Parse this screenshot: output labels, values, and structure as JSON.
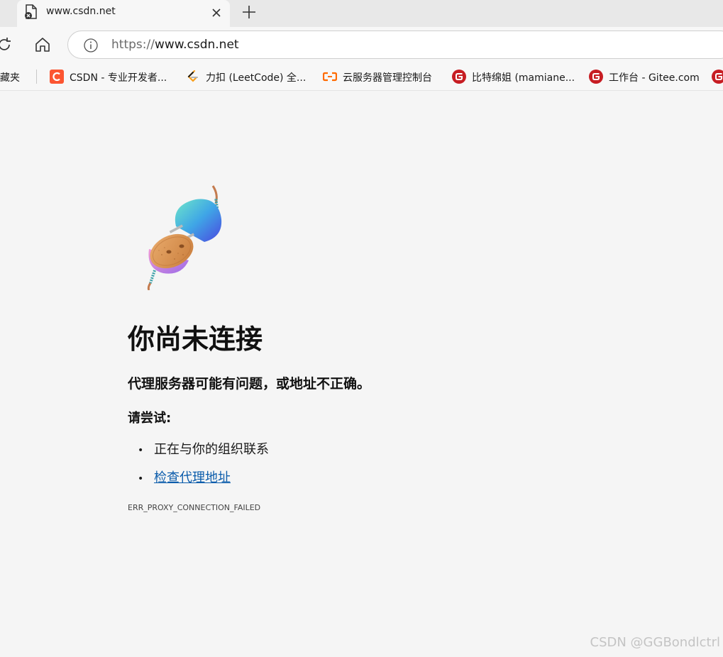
{
  "tab": {
    "title": "www.csdn.net",
    "icon": "page-error-icon",
    "close_icon": "close-icon",
    "new_tab_icon": "plus-icon"
  },
  "toolbar": {
    "refresh_icon": "refresh-icon",
    "home_icon": "home-icon",
    "info_icon": "info-icon",
    "url_scheme": "https://",
    "url_host": "www.csdn.net"
  },
  "bookmarks": {
    "favorites_label": "收藏夹",
    "items": [
      {
        "label": "CSDN - 专业开发者...",
        "icon": "csdn-icon",
        "color": "#fc5531"
      },
      {
        "label": "力扣 (LeetCode) 全...",
        "icon": "leetcode-icon",
        "color": "#f89f1b"
      },
      {
        "label": "云服务器管理控制台",
        "icon": "aliyun-icon",
        "color": "#ff6a00"
      },
      {
        "label": "比特绵姐 (mamiane...",
        "icon": "gitee-icon",
        "color": "#c71d23"
      },
      {
        "label": "工作台 - Gitee.com",
        "icon": "gitee-icon",
        "color": "#c71d23"
      },
      {
        "label": "",
        "icon": "gitee-icon",
        "color": "#c71d23"
      }
    ]
  },
  "error_page": {
    "illustration": "disconnected-plug-illustration",
    "heading": "你尚未连接",
    "subheading": "代理服务器可能有问题，或地址不正确。",
    "try_label": "请尝试:",
    "suggestions": [
      {
        "text": "正在与你的组织联系",
        "is_link": false
      },
      {
        "text": "检查代理地址",
        "is_link": true
      }
    ],
    "bullet": "•",
    "error_code": "ERR_PROXY_CONNECTION_FAILED"
  },
  "watermark": "CSDN @GGBondlctrl",
  "colors": {
    "background": "#f5f5f5",
    "link": "#0b5cab",
    "tabstrip": "#e8e8e8"
  }
}
